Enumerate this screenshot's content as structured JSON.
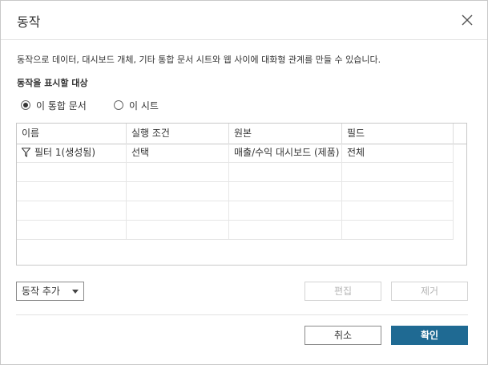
{
  "dialog": {
    "title": "동작",
    "close_icon": "close-icon"
  },
  "description": "동작으로 데이터, 대시보드 개체, 기타 통합 문서 시트와 웹 사이에 대화형 관계를 만들 수 있습니다.",
  "scope": {
    "label": "동작을 표시할 대상",
    "options": [
      {
        "label": "이 통합 문서",
        "checked": true
      },
      {
        "label": "이 시트",
        "checked": false
      }
    ]
  },
  "table": {
    "columns": [
      "이름",
      "실행 조건",
      "원본",
      "필드"
    ],
    "rows": [
      {
        "icon": "filter-icon",
        "name": "필터 1(생성됨)",
        "trigger": "선택",
        "source": "매출/수익 대시보드 (제품)",
        "fields": "전체"
      }
    ]
  },
  "buttons": {
    "add_action": "동작 추가",
    "edit": "편집",
    "remove": "제거",
    "cancel": "취소",
    "ok": "확인"
  },
  "colors": {
    "primary": "#1f6a93",
    "border": "#c8c8c8",
    "disabled_text": "#b5b5b5"
  }
}
